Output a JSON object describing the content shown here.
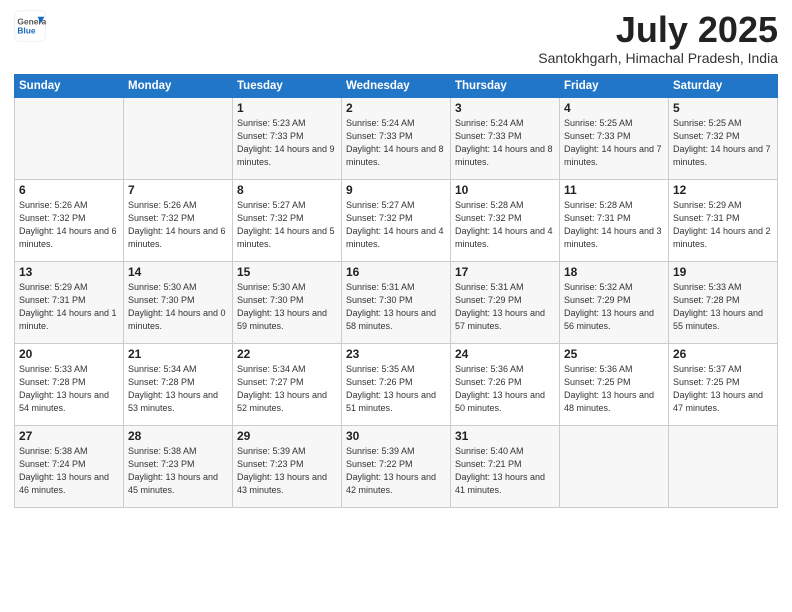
{
  "logo": {
    "general": "General",
    "blue": "Blue"
  },
  "title": {
    "month": "July 2025",
    "location": "Santokhgarh, Himachal Pradesh, India"
  },
  "weekdays": [
    "Sunday",
    "Monday",
    "Tuesday",
    "Wednesday",
    "Thursday",
    "Friday",
    "Saturday"
  ],
  "weeks": [
    [
      {
        "day": "",
        "info": ""
      },
      {
        "day": "",
        "info": ""
      },
      {
        "day": "1",
        "info": "Sunrise: 5:23 AM\nSunset: 7:33 PM\nDaylight: 14 hours and 9 minutes."
      },
      {
        "day": "2",
        "info": "Sunrise: 5:24 AM\nSunset: 7:33 PM\nDaylight: 14 hours and 8 minutes."
      },
      {
        "day": "3",
        "info": "Sunrise: 5:24 AM\nSunset: 7:33 PM\nDaylight: 14 hours and 8 minutes."
      },
      {
        "day": "4",
        "info": "Sunrise: 5:25 AM\nSunset: 7:33 PM\nDaylight: 14 hours and 7 minutes."
      },
      {
        "day": "5",
        "info": "Sunrise: 5:25 AM\nSunset: 7:32 PM\nDaylight: 14 hours and 7 minutes."
      }
    ],
    [
      {
        "day": "6",
        "info": "Sunrise: 5:26 AM\nSunset: 7:32 PM\nDaylight: 14 hours and 6 minutes."
      },
      {
        "day": "7",
        "info": "Sunrise: 5:26 AM\nSunset: 7:32 PM\nDaylight: 14 hours and 6 minutes."
      },
      {
        "day": "8",
        "info": "Sunrise: 5:27 AM\nSunset: 7:32 PM\nDaylight: 14 hours and 5 minutes."
      },
      {
        "day": "9",
        "info": "Sunrise: 5:27 AM\nSunset: 7:32 PM\nDaylight: 14 hours and 4 minutes."
      },
      {
        "day": "10",
        "info": "Sunrise: 5:28 AM\nSunset: 7:32 PM\nDaylight: 14 hours and 4 minutes."
      },
      {
        "day": "11",
        "info": "Sunrise: 5:28 AM\nSunset: 7:31 PM\nDaylight: 14 hours and 3 minutes."
      },
      {
        "day": "12",
        "info": "Sunrise: 5:29 AM\nSunset: 7:31 PM\nDaylight: 14 hours and 2 minutes."
      }
    ],
    [
      {
        "day": "13",
        "info": "Sunrise: 5:29 AM\nSunset: 7:31 PM\nDaylight: 14 hours and 1 minute."
      },
      {
        "day": "14",
        "info": "Sunrise: 5:30 AM\nSunset: 7:30 PM\nDaylight: 14 hours and 0 minutes."
      },
      {
        "day": "15",
        "info": "Sunrise: 5:30 AM\nSunset: 7:30 PM\nDaylight: 13 hours and 59 minutes."
      },
      {
        "day": "16",
        "info": "Sunrise: 5:31 AM\nSunset: 7:30 PM\nDaylight: 13 hours and 58 minutes."
      },
      {
        "day": "17",
        "info": "Sunrise: 5:31 AM\nSunset: 7:29 PM\nDaylight: 13 hours and 57 minutes."
      },
      {
        "day": "18",
        "info": "Sunrise: 5:32 AM\nSunset: 7:29 PM\nDaylight: 13 hours and 56 minutes."
      },
      {
        "day": "19",
        "info": "Sunrise: 5:33 AM\nSunset: 7:28 PM\nDaylight: 13 hours and 55 minutes."
      }
    ],
    [
      {
        "day": "20",
        "info": "Sunrise: 5:33 AM\nSunset: 7:28 PM\nDaylight: 13 hours and 54 minutes."
      },
      {
        "day": "21",
        "info": "Sunrise: 5:34 AM\nSunset: 7:28 PM\nDaylight: 13 hours and 53 minutes."
      },
      {
        "day": "22",
        "info": "Sunrise: 5:34 AM\nSunset: 7:27 PM\nDaylight: 13 hours and 52 minutes."
      },
      {
        "day": "23",
        "info": "Sunrise: 5:35 AM\nSunset: 7:26 PM\nDaylight: 13 hours and 51 minutes."
      },
      {
        "day": "24",
        "info": "Sunrise: 5:36 AM\nSunset: 7:26 PM\nDaylight: 13 hours and 50 minutes."
      },
      {
        "day": "25",
        "info": "Sunrise: 5:36 AM\nSunset: 7:25 PM\nDaylight: 13 hours and 48 minutes."
      },
      {
        "day": "26",
        "info": "Sunrise: 5:37 AM\nSunset: 7:25 PM\nDaylight: 13 hours and 47 minutes."
      }
    ],
    [
      {
        "day": "27",
        "info": "Sunrise: 5:38 AM\nSunset: 7:24 PM\nDaylight: 13 hours and 46 minutes."
      },
      {
        "day": "28",
        "info": "Sunrise: 5:38 AM\nSunset: 7:23 PM\nDaylight: 13 hours and 45 minutes."
      },
      {
        "day": "29",
        "info": "Sunrise: 5:39 AM\nSunset: 7:23 PM\nDaylight: 13 hours and 43 minutes."
      },
      {
        "day": "30",
        "info": "Sunrise: 5:39 AM\nSunset: 7:22 PM\nDaylight: 13 hours and 42 minutes."
      },
      {
        "day": "31",
        "info": "Sunrise: 5:40 AM\nSunset: 7:21 PM\nDaylight: 13 hours and 41 minutes."
      },
      {
        "day": "",
        "info": ""
      },
      {
        "day": "",
        "info": ""
      }
    ]
  ]
}
